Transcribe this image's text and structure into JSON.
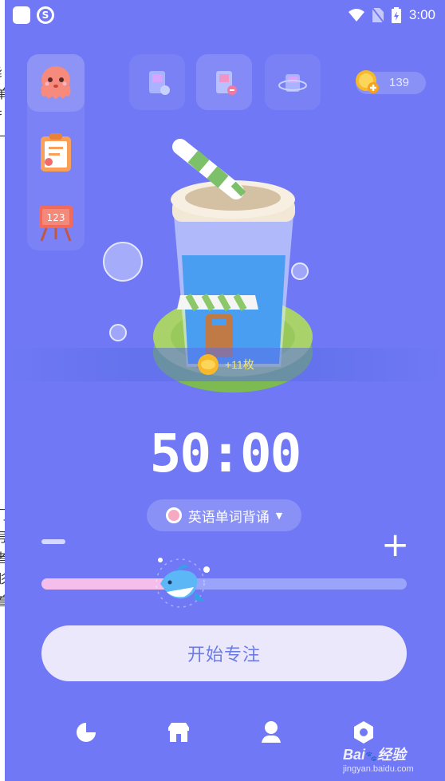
{
  "status_bar": {
    "time": "3:00",
    "app_badge": "S"
  },
  "coins": {
    "count": "139"
  },
  "reward": {
    "text": "+11枚"
  },
  "timer": {
    "value": "50:00"
  },
  "task": {
    "label": "英语单词背诵"
  },
  "slider": {
    "level": 0.38
  },
  "start_button": {
    "label": "开始专注"
  },
  "watermark": {
    "brand_a": "Bai",
    "brand_b": "经验",
    "url": "jingyan.baidu.com"
  },
  "edge_fragments": [
    "纟",
    "单",
    "扌",
    "—",
    "门",
    "号",
    "者",
    "肜",
    "着"
  ],
  "icons": {
    "left": [
      "octopus-avatar-icon",
      "clipboard-icon",
      "easel-board-icon"
    ],
    "top": [
      "scene-add-icon",
      "scene-remove-icon",
      "scene-rotate-icon"
    ],
    "nav": [
      "moon-icon",
      "shop-icon",
      "profile-icon",
      "settings-icon"
    ]
  },
  "colors": {
    "background": "#7078f5",
    "accent_pink": "#f5bdeb",
    "button_text": "#6b7be6",
    "reward_text": "#f4ea6a"
  }
}
